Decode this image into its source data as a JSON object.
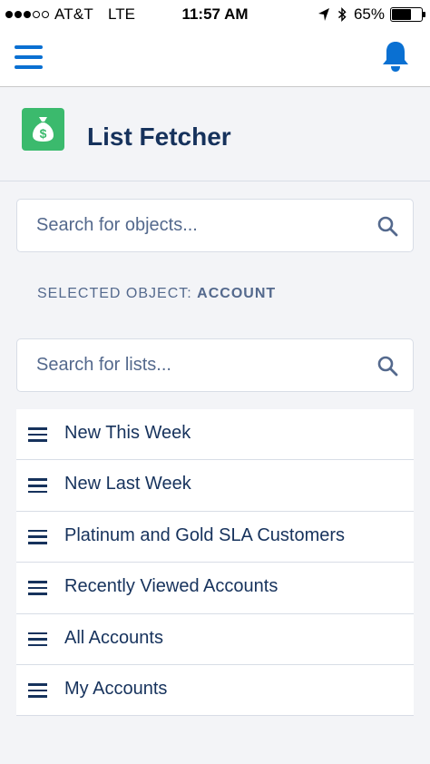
{
  "status_bar": {
    "carrier": "AT&T",
    "network": "LTE",
    "time": "11:57 AM",
    "battery": "65%",
    "battery_level": 0.65
  },
  "header": {
    "menu_icon": "hamburger-menu-icon",
    "notification_icon": "bell-icon",
    "accent_color": "#0a70d2"
  },
  "page": {
    "title": "List Fetcher",
    "logo_icon": "money-bag-icon",
    "logo_color": "#3bba6d"
  },
  "object_search": {
    "placeholder": "Search for objects..."
  },
  "selected_object": {
    "label": "SELECTED OBJECT: ",
    "value": "ACCOUNT"
  },
  "list_search": {
    "placeholder": "Search for lists..."
  },
  "lists": [
    {
      "label": "New This Week"
    },
    {
      "label": "New Last Week"
    },
    {
      "label": "Platinum and Gold SLA Customers"
    },
    {
      "label": "Recently Viewed Accounts"
    },
    {
      "label": "All Accounts"
    },
    {
      "label": "My Accounts"
    }
  ]
}
